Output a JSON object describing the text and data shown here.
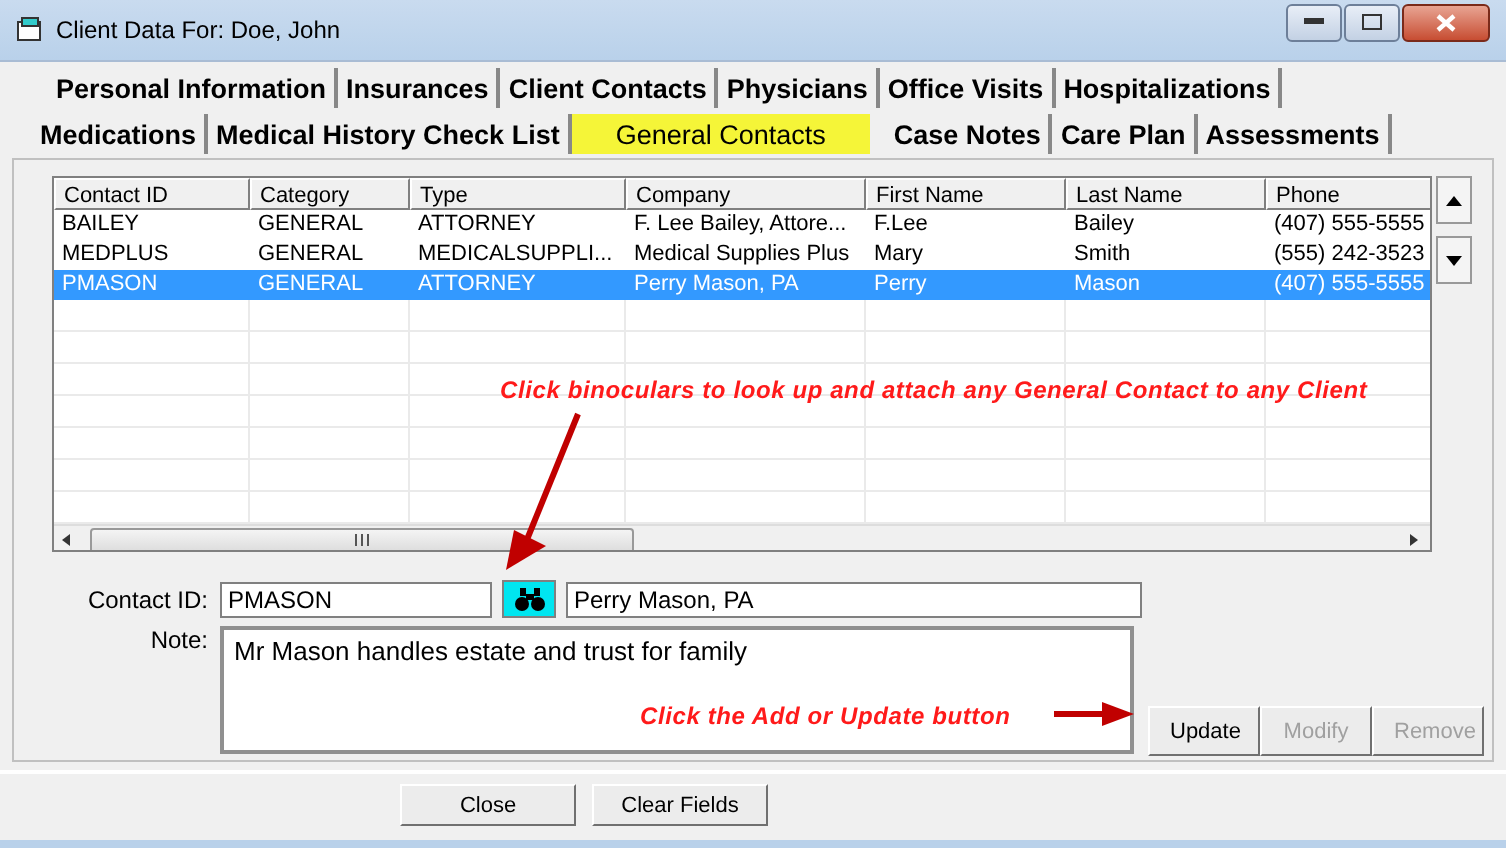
{
  "window": {
    "title": "Client Data For: Doe, John"
  },
  "tab_rows": [
    [
      {
        "label": "Personal Information",
        "selected": false
      },
      {
        "label": "Insurances",
        "selected": false
      },
      {
        "label": "Client Contacts",
        "selected": false
      },
      {
        "label": "Physicians",
        "selected": false
      },
      {
        "label": "Office Visits",
        "selected": false
      },
      {
        "label": "Hospitalizations",
        "selected": false
      }
    ],
    [
      {
        "label": "Medications",
        "selected": false
      },
      {
        "label": "Medical History Check List",
        "selected": false
      },
      {
        "label": "General Contacts",
        "selected": true
      },
      {
        "label": "Case Notes",
        "selected": false
      },
      {
        "label": "Care Plan",
        "selected": false
      },
      {
        "label": "Assessments",
        "selected": false
      }
    ]
  ],
  "table": {
    "columns": [
      "Contact ID",
      "Category",
      "Type",
      "Company",
      "First Name",
      "Last Name",
      "Phone"
    ],
    "rows": [
      {
        "cells": [
          "BAILEY",
          "GENERAL",
          "ATTORNEY",
          "F. Lee Bailey, Attore...",
          "F.Lee",
          "Bailey",
          "(407) 555-5555"
        ],
        "selected": false
      },
      {
        "cells": [
          "MEDPLUS",
          "GENERAL",
          "MEDICALSUPPLI...",
          "Medical Supplies Plus",
          "Mary",
          "Smith",
          "(555) 242-3523"
        ],
        "selected": false
      },
      {
        "cells": [
          "PMASON",
          "GENERAL",
          "ATTORNEY",
          "Perry Mason, PA",
          "Perry",
          "Mason",
          "(407) 555-5555"
        ],
        "selected": true
      }
    ]
  },
  "annotations": [
    "Click binoculars to look up and attach any General Contact to any Client",
    "Click the Add or Update button"
  ],
  "form": {
    "contact_id_label": "Contact ID:",
    "contact_id": "PMASON",
    "company": "Perry Mason, PA",
    "note_label": "Note:",
    "note": "Mr Mason handles estate and trust for family"
  },
  "row_buttons": [
    {
      "label": "Update",
      "disabled": false
    },
    {
      "label": "Modify",
      "disabled": true
    },
    {
      "label": "Remove",
      "disabled": true
    }
  ],
  "footer_buttons": [
    "Close",
    "Clear Fields"
  ]
}
